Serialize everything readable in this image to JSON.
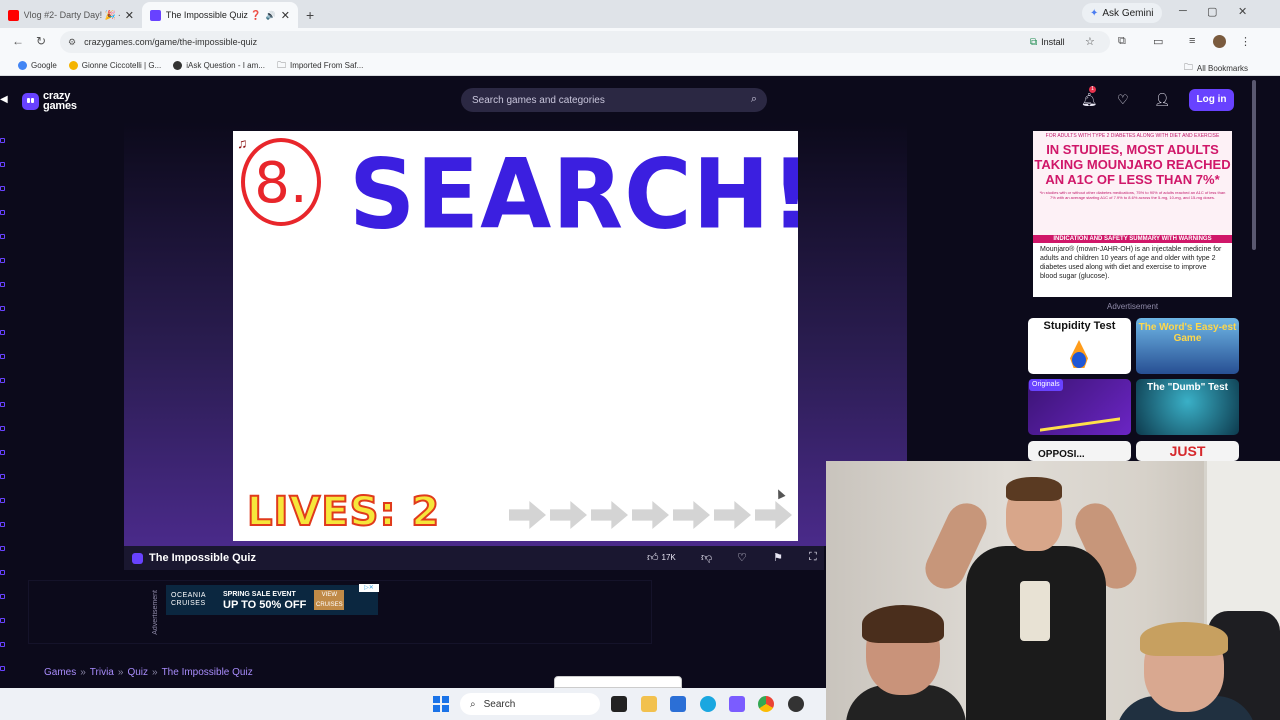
{
  "browser": {
    "tabs": [
      {
        "label": "Vlog #2- Darty Day! 🎉 - YouTu",
        "active": false
      },
      {
        "label": "The Impossible Quiz ❓ Pla",
        "active": true
      }
    ],
    "new_tab": "+",
    "gemini_label": "Ask Gemini",
    "url": "crazygames.com/game/the-impossible-quiz",
    "install_label": "Install",
    "bookmarks": [
      "Google",
      "Gionne Ciccotelli | G...",
      "iAsk Question - I am...",
      "Imported From Saf..."
    ],
    "all_bookmarks": "All Bookmarks"
  },
  "site": {
    "logo_line1": "crazy",
    "logo_line2": "games",
    "search_placeholder": "Search games and categories",
    "notification_count": "1",
    "login_label": "Log in"
  },
  "game": {
    "question_number": "8.",
    "question_text": "SEARCH!",
    "lives_text": "LIVES: 2",
    "skips_remaining": 7,
    "title": "The Impossible Quiz",
    "likes": "17K"
  },
  "ad_banner": {
    "brand": "OCEANIA CRUISES",
    "headline": "SPRING SALE EVENT",
    "offer": "UP TO 50% OFF",
    "cta": "VIEW CRUISES",
    "advertisement_label": "Advertisement"
  },
  "breadcrumb": [
    "Games",
    "Trivia",
    "Quiz",
    "The Impossible Quiz"
  ],
  "side_ad": {
    "small_top": "FOR ADULTS WITH TYPE 2 DIABETES ALONG WITH DIET AND EXERCISE",
    "headline": "IN STUDIES, MOST ADULTS TAKING MOUNJARO REACHED AN A1C OF LESS THAN 7%*",
    "fine_print": "*In studies with or without other diabetes medications, 75% to 90% of adults reached an A1C of less than 7% with an average starting A1C of 7.9% to 8.6% across the 5-mg, 10-mg, and 15-mg doses.",
    "bar": "INDICATION AND SAFETY SUMMARY WITH WARNINGS",
    "body": "Mounjaro® (mown-JAHR-OH) is an injectable medicine for adults and children 10 years of age and older with type 2 diabetes used along with diet and exercise to improve blood sugar (glucose).",
    "label": "Advertisement"
  },
  "thumbnails": [
    {
      "title": "Stupidity Test"
    },
    {
      "title": "The Word's Easy-est Game"
    },
    {
      "title": "Originals"
    },
    {
      "title": "The \"Dumb\" Test"
    },
    {
      "title": "OPPOSI..."
    },
    {
      "title": "JUST"
    }
  ],
  "taskbar": {
    "search_label": "Search"
  },
  "colors": {
    "brand": "#6842ff",
    "question_blue": "#3b1fe0",
    "question_red": "#e8262b",
    "page_bg": "#0c0a1b"
  }
}
